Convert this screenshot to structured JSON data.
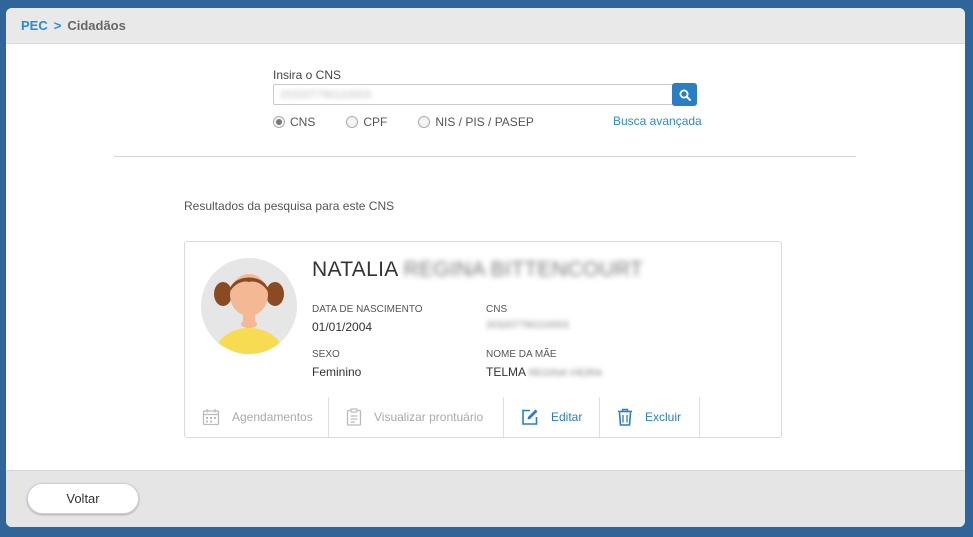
{
  "breadcrumb": {
    "root": "PEC",
    "separator": ">",
    "current": "Cidadãos"
  },
  "search": {
    "label": "Insira o CNS",
    "value": "203207790110003",
    "button_icon": "search-icon",
    "options": [
      {
        "label": "CNS",
        "selected": true
      },
      {
        "label": "CPF",
        "selected": false
      },
      {
        "label": "NIS / PIS / PASEP",
        "selected": false
      }
    ],
    "advanced_link": "Busca avançada"
  },
  "results": {
    "heading": "Resultados da pesquisa para este CNS",
    "card": {
      "first_name": "NATALIA",
      "rest_name": "REGINA BITTENCOURT",
      "birth_label": "DATA DE NASCIMENTO",
      "birth_value": "01/01/2004",
      "cns_label": "CNS",
      "cns_value": "203207790110003",
      "sex_label": "SEXO",
      "sex_value": "Feminino",
      "mother_label": "NOME DA MÃE",
      "mother_first": "TELMA",
      "mother_rest": "REGINA VIEIRA",
      "actions": {
        "agendamentos": "Agendamentos",
        "prontuario": "Visualizar prontuário",
        "editar": "Editar",
        "excluir": "Excluir"
      }
    }
  },
  "footer": {
    "back_label": "Voltar"
  },
  "colors": {
    "frame": "#30659a",
    "accent": "#2a7ec3",
    "link": "#2a8ad4",
    "avatar_shirt": "#f7dc52",
    "avatar_hair": "#8a4a22"
  }
}
